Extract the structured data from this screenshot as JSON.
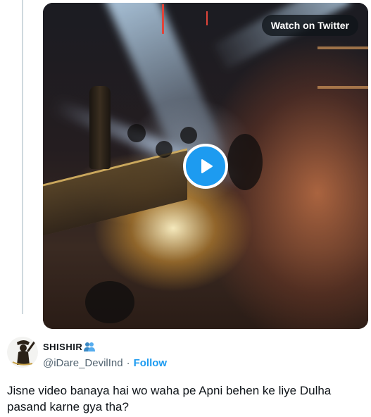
{
  "media": {
    "watch_label": "Watch on Twitter"
  },
  "quoted_author": {
    "display_name": "SHISHIR",
    "handle": "@iDare_DevilInd",
    "follow_label": "Follow",
    "separator": "·"
  },
  "tweet": {
    "text": "Jisne video banaya hai wo waha pe Apni behen ke liye Dulha pasand karne gya tha?"
  },
  "colors": {
    "accent": "#1d9bf0",
    "text_primary": "#0f1419",
    "text_secondary": "#536471",
    "thread_line": "#cfd9de"
  },
  "icons": {
    "play": "play-icon",
    "name_badge": "people-emoji-icon",
    "avatar": "avatar-silhouette"
  }
}
